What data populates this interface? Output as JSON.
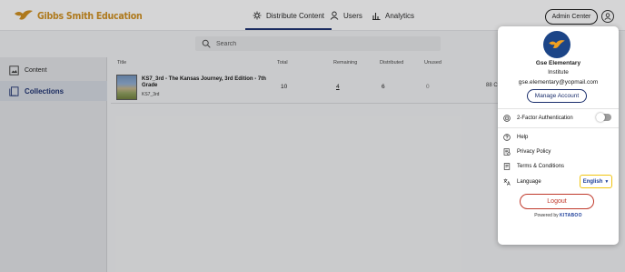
{
  "header": {
    "logo_text": "Gibbs Smith Education",
    "nav": [
      {
        "label": "Distribute Content",
        "icon": "distribute-icon",
        "active": true
      },
      {
        "label": "Users",
        "icon": "user-icon",
        "active": false
      },
      {
        "label": "Analytics",
        "icon": "chart-icon",
        "active": false
      }
    ],
    "admin_center_label": "Admin Center",
    "avatar_icon": "user-circle-icon"
  },
  "search": {
    "placeholder": "Search",
    "value": ""
  },
  "sidebar": {
    "items": [
      {
        "label": "Content",
        "icon": "content-icon",
        "active": false
      },
      {
        "label": "Collections",
        "icon": "collections-icon",
        "active": true
      }
    ]
  },
  "table": {
    "columns": [
      "Title",
      "Total",
      "Remaining",
      "Distributed",
      "Unused"
    ],
    "rows": [
      {
        "title": "KS7_3rd - The Kansas Journey, 3rd Edition - 7th Grade",
        "subtitle": "KS7_3rd",
        "total": "10",
        "remaining": "4",
        "distributed": "6",
        "unused": "0",
        "more": "88 C"
      }
    ]
  },
  "account_menu": {
    "name": "Gse Elementary",
    "role": "Institute",
    "email": "gse.elementary@yopmail.com",
    "manage_account_label": "Manage Account",
    "two_factor_label": "2-Factor Authentication",
    "two_factor_enabled": false,
    "items": [
      {
        "label": "Help",
        "icon": "help-icon"
      },
      {
        "label": "Privacy Policy",
        "icon": "privacy-icon"
      },
      {
        "label": "Terms & Conditions",
        "icon": "terms-icon"
      }
    ],
    "language_label": "Language",
    "language_value": "English",
    "logout_label": "Logout",
    "powered_by_label": "Powered by",
    "powered_by_brand": "KITABOO"
  },
  "colors": {
    "brand_orange": "#c98a1c",
    "navy": "#1a2e6c",
    "logout_red": "#c0392b",
    "highlight_yellow": "#f1c40f"
  }
}
